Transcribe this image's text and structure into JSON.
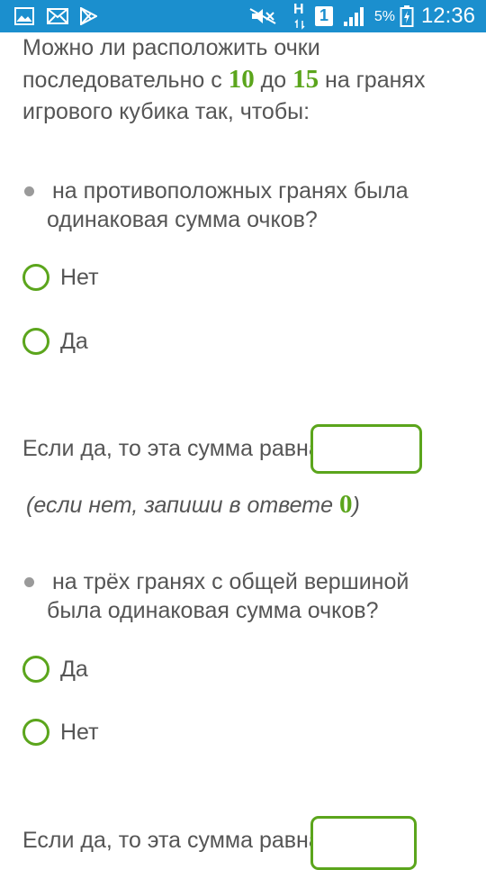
{
  "status_bar": {
    "battery_percent": "5%",
    "time": "12:36",
    "network_badge": "1",
    "data_indicator": "H",
    "color": "#1b8fce"
  },
  "question": {
    "intro_part1": "Можно ли расположить очки последовательно с ",
    "from_number": "10",
    "intro_part2": " до ",
    "to_number": "15",
    "intro_part3": " на гранях игрового кубика так, чтобы:"
  },
  "section1": {
    "bullet_text": "на противоположных гранях была одинаковая сумма очков?",
    "options": [
      {
        "label": "Нет"
      },
      {
        "label": "Да"
      }
    ],
    "sum_label": "Если да, то эта сумма равна",
    "sum_value": "",
    "hint_open": "(",
    "hint_text": "если нет, запиши в ответе ",
    "hint_number": "0",
    "hint_close": ")"
  },
  "section2": {
    "bullet_text": "на трёх гранях с общей вершиной была одинаковая сумма очков?",
    "options": [
      {
        "label": "Да"
      },
      {
        "label": "Нет"
      }
    ],
    "sum_label": "Если да, то эта сумма равна",
    "sum_value": ""
  },
  "colors": {
    "accent_green": "#5ba51c",
    "text": "#555555"
  }
}
